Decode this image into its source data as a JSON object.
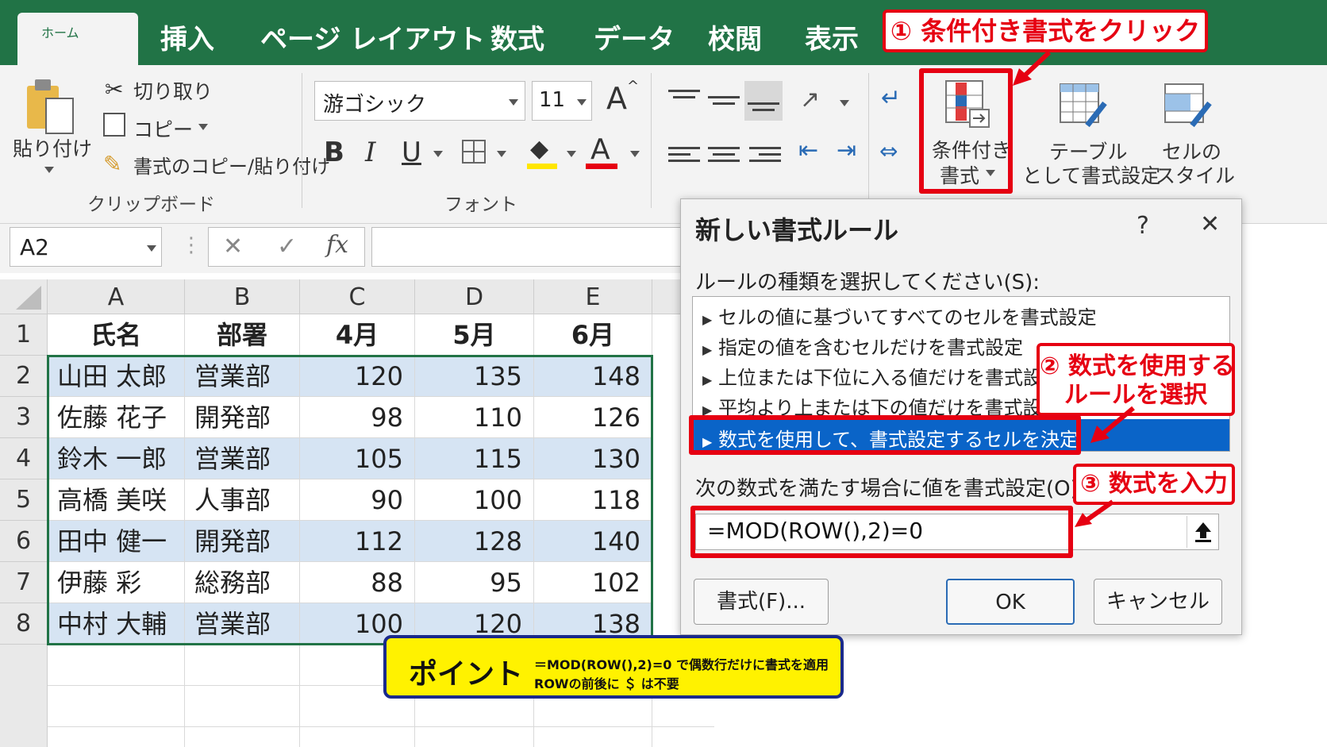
{
  "tabs": {
    "home": "ホーム",
    "insert": "挿入",
    "page_layout": "ページ レイアウト",
    "formulas": "数式",
    "data": "データ",
    "review": "校閲",
    "view": "表示"
  },
  "clipboard": {
    "paste": "貼り付け",
    "cut": "切り取り",
    "copy": "コピー",
    "format_painter": "書式のコピー/貼り付け",
    "group_label": "クリップボード"
  },
  "font": {
    "name": "游ゴシック",
    "size": "11",
    "bold": "B",
    "italic": "I",
    "underline": "U",
    "font_color_glyph": "A",
    "grow_glyph": "A",
    "group_label": "フォント"
  },
  "styles": {
    "conditional_line1": "条件付き",
    "conditional_line2": "書式",
    "table_line1": "テーブル",
    "table_line2": "として書式設定",
    "cell_line1": "セルの",
    "cell_line2": "スタイル"
  },
  "formula_bar": {
    "name_box": "A2",
    "fx": "fx",
    "cancel": "✕",
    "enter": "✓"
  },
  "sheet": {
    "columns": [
      "A",
      "B",
      "C",
      "D",
      "E"
    ],
    "rows": [
      "1",
      "2",
      "3",
      "4",
      "5",
      "6",
      "7",
      "8"
    ],
    "header": [
      "氏名",
      "部署",
      "4月",
      "5月",
      "6月"
    ],
    "data": [
      [
        "山田 太郎",
        "営業部",
        "120",
        "135",
        "148"
      ],
      [
        "佐藤 花子",
        "開発部",
        "98",
        "110",
        "126"
      ],
      [
        "鈴木 一郎",
        "営業部",
        "105",
        "115",
        "130"
      ],
      [
        "高橋 美咲",
        "人事部",
        "90",
        "100",
        "118"
      ],
      [
        "田中 健一",
        "開発部",
        "112",
        "128",
        "140"
      ],
      [
        "伊藤 彩",
        "総務部",
        "88",
        "95",
        "102"
      ],
      [
        "中村 大輔",
        "営業部",
        "100",
        "120",
        "138"
      ]
    ]
  },
  "dialog": {
    "title": "新しい書式ルール",
    "help": "?",
    "close": "✕",
    "rule_type_label": "ルールの種類を選択してください(S):",
    "rules": [
      "セルの値に基づいてすべてのセルを書式設定",
      "指定の値を含むセルだけを書式設定",
      "上位または下位に入る値だけを書式設定",
      "平均より上または下の値だけを書式設定",
      "数式を使用して、書式設定するセルを決定"
    ],
    "formula_label": "次の数式を満たす場合に値を書式設定(O):",
    "formula": "=MOD(ROW(),2)=0",
    "format_button": "書式(F)...",
    "ok": "OK",
    "cancel": "キャンセル"
  },
  "callouts": {
    "step1": "① 条件付き書式をクリック",
    "step2_line1": "② 数式を使用する",
    "step2_line2": "ルールを選択",
    "step3": "③ 数式を入力"
  },
  "point": {
    "title": "ポイント",
    "line1": "＝MOD(ROW(),2)=0 で偶数行だけに書式を適用",
    "line2": "ROWの前後に ＄ は不要"
  },
  "colors": {
    "excel_green": "#217346",
    "band_blue": "#d6e4f3",
    "callout_red": "#e60012",
    "selection_blue": "#0a64c8",
    "point_yellow": "#fff200"
  }
}
